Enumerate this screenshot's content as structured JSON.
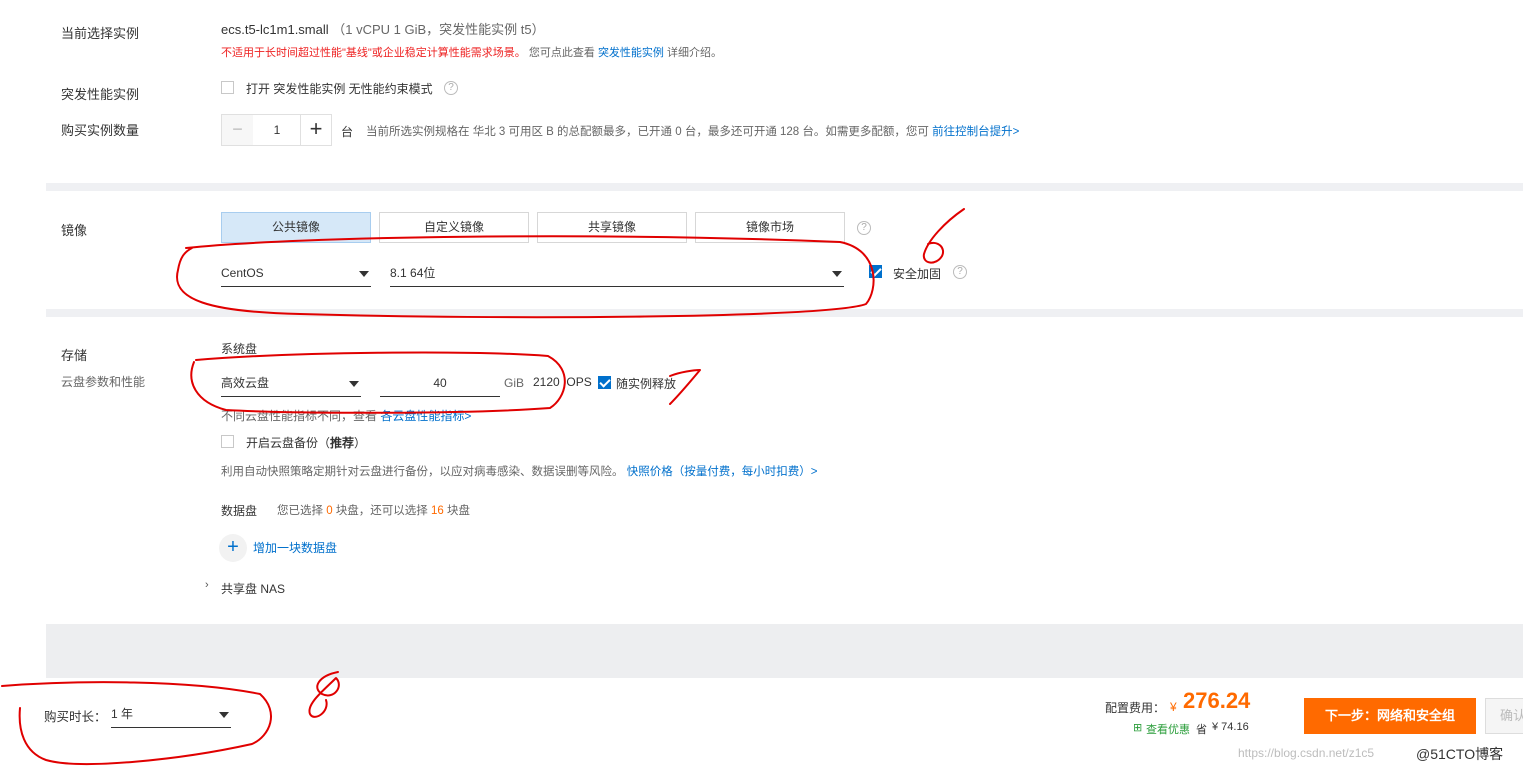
{
  "instance": {
    "label": "当前选择实例",
    "spec": "ecs.t5-lc1m1.small",
    "spec_detail": "（1 vCPU 1 GiB，突发性能实例 t5）",
    "warning": "不适用于长时间超过性能\"基线\"或企业稳定计算性能需求场景。",
    "note_prefix": "您可点此查看",
    "note_link": "突发性能实例",
    "note_suffix": "详细介绍。"
  },
  "burst": {
    "label": "突发性能实例",
    "option_text": "打开 突发性能实例 无性能约束模式"
  },
  "quantity": {
    "label": "购买实例数量",
    "minus": "−",
    "value": "1",
    "plus": "+",
    "unit": "台",
    "info": "当前所选实例规格在 华北 3 可用区 B 的总配额最多，已开通 0 台，最多还可开通 128 台。如需更多配额，您可",
    "link": "前往控制台提升>"
  },
  "image": {
    "label": "镜像",
    "tabs": [
      "公共镜像",
      "自定义镜像",
      "共享镜像",
      "镜像市场"
    ],
    "os": "CentOS",
    "version": "8.1 64位",
    "security_label": "安全加固"
  },
  "storage": {
    "label": "存储",
    "sublabel": "云盘参数和性能",
    "system_disk_label": "系统盘",
    "disk_type": "高效云盘",
    "disk_size": "40",
    "unit": "GiB",
    "iops": "2120 IOPS",
    "release_label": "随实例释放",
    "perf_note": "不同云盘性能指标不同，查看",
    "perf_link": "各云盘性能指标>",
    "backup_label": "开启云盘备份（",
    "backup_recommend": "推荐",
    "backup_close": "）",
    "backup_note": "利用自动快照策略定期针对云盘进行备份，以应对病毒感染、数据误删等风险。",
    "backup_link": "快照价格（按量付费，每小时扣费）>",
    "data_disk_label": "数据盘",
    "data_disk_info_1": "您已选择",
    "data_disk_selected": "0",
    "data_disk_info_2": "块盘，还可以选择",
    "data_disk_remaining": "16",
    "data_disk_info_3": "块盘",
    "add_disk_label": "增加一块数据盘",
    "nas_label": "共享盘 NAS"
  },
  "footer": {
    "duration_label": "购买时长：",
    "duration_value": "1 年",
    "price_label": "配置费用：",
    "currency": "¥",
    "price": "276.24",
    "discount_link": "查看优惠",
    "save_label": "省",
    "save_amount": "¥ 74.16",
    "next_button": "下一步：网络和安全组",
    "confirm_button": "确认",
    "watermark_url": "https://blog.csdn.net/z1c5",
    "watermark_brand": "@51CTO博客"
  },
  "annotations": [
    "6",
    "7",
    "8"
  ],
  "colors": {
    "accent_blue": "#0070cc",
    "orange": "#ff6a00",
    "warning_red": "#e22222",
    "tab_active_bg": "#d6e8f8",
    "annotation_red": "#e00000"
  }
}
